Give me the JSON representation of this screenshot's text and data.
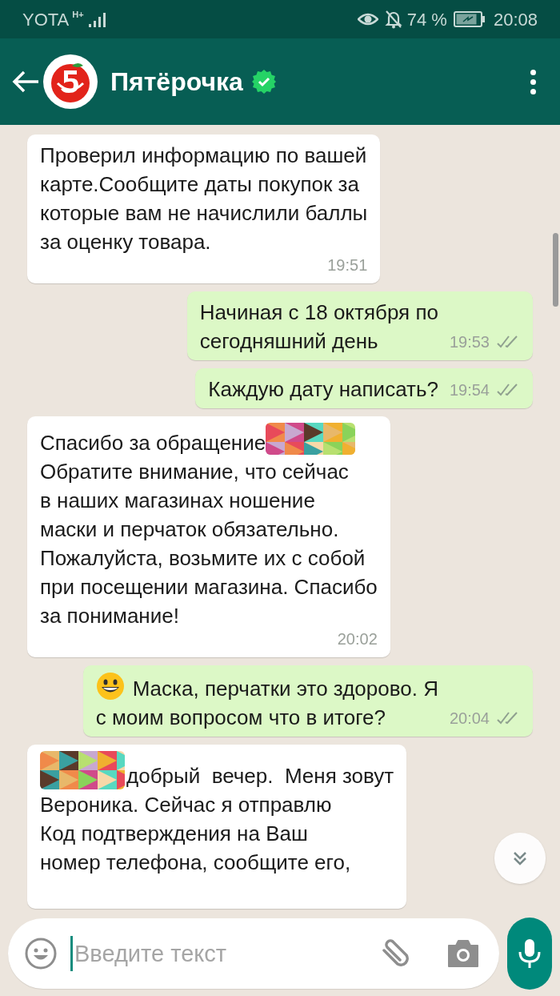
{
  "status_bar": {
    "carrier": "YOTA",
    "network": "H+",
    "battery": "74 %",
    "time": "20:08"
  },
  "header": {
    "title": "Пятёрочка",
    "verified": true
  },
  "messages": [
    {
      "kind": "incoming",
      "text": "Проверил информацию по вашей\nкарте.Сообщите даты покупок за\nкоторые вам не начислили баллы\nза оценку товара.",
      "time": "19:51"
    },
    {
      "kind": "outgoing",
      "text": "Начиная с 18 октября по\nсегодняшний день",
      "time": "19:53",
      "delivered": true
    },
    {
      "kind": "outgoing",
      "text": "Каждую дату написать?",
      "time": "19:54",
      "delivered": true
    },
    {
      "kind": "incoming",
      "redacted_after_first": true,
      "text": "Спасибо за обращение",
      "text_rest": "Обратите внимание, что сейчас\nв наших магазинах ношение\nмаски и перчаток обязательно.\nПожалуйста, возьмите их с собой\nпри посещении магазина. Спасибо\nза понимание!",
      "time": "20:02"
    },
    {
      "kind": "outgoing",
      "smiley_before": true,
      "text": "Маска, перчатки это здорово. Я",
      "text_rest": "с моим вопросом что в итоге?",
      "time": "20:04",
      "delivered": true
    },
    {
      "kind": "incoming",
      "redacted_before": true,
      "text": "добрый  вечер.  Меня зовут",
      "text_rest": "Вероника. Сейчас я отправлю\nКод подтверждения на Ваш\nномер телефона, сообщите его,"
    }
  ],
  "composer": {
    "placeholder": "Введите текст"
  }
}
